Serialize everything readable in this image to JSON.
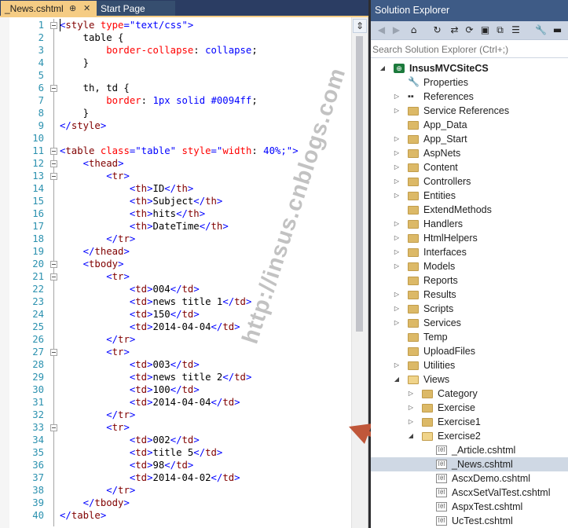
{
  "editor": {
    "tabs": [
      {
        "label": "_News.cshtml",
        "pin": "⊕",
        "close": "✕"
      },
      {
        "label": "Start Page"
      }
    ],
    "split_glyph": "⇕",
    "lines": [
      {
        "n": "1",
        "fold": true,
        "t": [
          [
            "b",
            "<"
          ],
          [
            "m",
            "style"
          ],
          [
            "r",
            " type"
          ],
          [
            "b",
            "=\""
          ],
          [
            "b",
            "text/css"
          ],
          [
            "b",
            "\">"
          ]
        ]
      },
      {
        "n": "2",
        "t": [
          [
            "k",
            "    table "
          ],
          [
            "k",
            "{"
          ]
        ]
      },
      {
        "n": "3",
        "t": [
          [
            "r",
            "        border-collapse"
          ],
          [
            "k",
            ": "
          ],
          [
            "b",
            "collapse"
          ],
          [
            "k",
            ";"
          ]
        ]
      },
      {
        "n": "4",
        "t": [
          [
            "k",
            "    }"
          ]
        ]
      },
      {
        "n": "5",
        "t": []
      },
      {
        "n": "6",
        "fold": true,
        "t": [
          [
            "k",
            "    th, td {"
          ]
        ]
      },
      {
        "n": "7",
        "t": [
          [
            "r",
            "        border"
          ],
          [
            "k",
            ": "
          ],
          [
            "b",
            "1px solid #0094ff"
          ],
          [
            "k",
            ";"
          ]
        ]
      },
      {
        "n": "8",
        "t": [
          [
            "k",
            "    }"
          ]
        ]
      },
      {
        "n": "9",
        "t": [
          [
            "b",
            "</"
          ],
          [
            "m",
            "style"
          ],
          [
            "b",
            ">"
          ]
        ]
      },
      {
        "n": "10",
        "t": []
      },
      {
        "n": "11",
        "fold": true,
        "t": [
          [
            "b",
            "<"
          ],
          [
            "m",
            "table"
          ],
          [
            "r",
            " class"
          ],
          [
            "b",
            "=\"table\""
          ],
          [
            "r",
            " style"
          ],
          [
            "b",
            "=\""
          ],
          [
            "r",
            "width"
          ],
          [
            "k",
            ": "
          ],
          [
            "b",
            "40%;"
          ],
          [
            "b",
            "\">"
          ]
        ]
      },
      {
        "n": "12",
        "fold": true,
        "t": [
          [
            "b",
            "    <"
          ],
          [
            "m",
            "thead"
          ],
          [
            "b",
            ">"
          ]
        ]
      },
      {
        "n": "13",
        "fold": true,
        "t": [
          [
            "b",
            "        <"
          ],
          [
            "m",
            "tr"
          ],
          [
            "b",
            ">"
          ]
        ]
      },
      {
        "n": "14",
        "t": [
          [
            "b",
            "            <"
          ],
          [
            "m",
            "th"
          ],
          [
            "b",
            ">"
          ],
          [
            "k",
            "ID"
          ],
          [
            "b",
            "</"
          ],
          [
            "m",
            "th"
          ],
          [
            "b",
            ">"
          ]
        ]
      },
      {
        "n": "15",
        "t": [
          [
            "b",
            "            <"
          ],
          [
            "m",
            "th"
          ],
          [
            "b",
            ">"
          ],
          [
            "k",
            "Subject"
          ],
          [
            "b",
            "</"
          ],
          [
            "m",
            "th"
          ],
          [
            "b",
            ">"
          ]
        ]
      },
      {
        "n": "16",
        "t": [
          [
            "b",
            "            <"
          ],
          [
            "m",
            "th"
          ],
          [
            "b",
            ">"
          ],
          [
            "k",
            "hits"
          ],
          [
            "b",
            "</"
          ],
          [
            "m",
            "th"
          ],
          [
            "b",
            ">"
          ]
        ]
      },
      {
        "n": "17",
        "t": [
          [
            "b",
            "            <"
          ],
          [
            "m",
            "th"
          ],
          [
            "b",
            ">"
          ],
          [
            "k",
            "DateTime"
          ],
          [
            "b",
            "</"
          ],
          [
            "m",
            "th"
          ],
          [
            "b",
            ">"
          ]
        ]
      },
      {
        "n": "18",
        "t": [
          [
            "b",
            "        </"
          ],
          [
            "m",
            "tr"
          ],
          [
            "b",
            ">"
          ]
        ]
      },
      {
        "n": "19",
        "t": [
          [
            "b",
            "    </"
          ],
          [
            "m",
            "thead"
          ],
          [
            "b",
            ">"
          ]
        ]
      },
      {
        "n": "20",
        "fold": true,
        "t": [
          [
            "b",
            "    <"
          ],
          [
            "m",
            "tbody"
          ],
          [
            "b",
            ">"
          ]
        ]
      },
      {
        "n": "21",
        "fold": true,
        "t": [
          [
            "b",
            "        <"
          ],
          [
            "m",
            "tr"
          ],
          [
            "b",
            ">"
          ]
        ]
      },
      {
        "n": "22",
        "t": [
          [
            "b",
            "            <"
          ],
          [
            "m",
            "td"
          ],
          [
            "b",
            ">"
          ],
          [
            "k",
            "004"
          ],
          [
            "b",
            "</"
          ],
          [
            "m",
            "td"
          ],
          [
            "b",
            ">"
          ]
        ]
      },
      {
        "n": "23",
        "t": [
          [
            "b",
            "            <"
          ],
          [
            "m",
            "td"
          ],
          [
            "b",
            ">"
          ],
          [
            "k",
            "news title 1"
          ],
          [
            "b",
            "</"
          ],
          [
            "m",
            "td"
          ],
          [
            "b",
            ">"
          ]
        ]
      },
      {
        "n": "24",
        "t": [
          [
            "b",
            "            <"
          ],
          [
            "m",
            "td"
          ],
          [
            "b",
            ">"
          ],
          [
            "k",
            "150"
          ],
          [
            "b",
            "</"
          ],
          [
            "m",
            "td"
          ],
          [
            "b",
            ">"
          ]
        ]
      },
      {
        "n": "25",
        "t": [
          [
            "b",
            "            <"
          ],
          [
            "m",
            "td"
          ],
          [
            "b",
            ">"
          ],
          [
            "k",
            "2014-04-04"
          ],
          [
            "b",
            "</"
          ],
          [
            "m",
            "td"
          ],
          [
            "b",
            ">"
          ]
        ]
      },
      {
        "n": "26",
        "t": [
          [
            "b",
            "        </"
          ],
          [
            "m",
            "tr"
          ],
          [
            "b",
            ">"
          ]
        ]
      },
      {
        "n": "27",
        "fold": true,
        "t": [
          [
            "b",
            "        <"
          ],
          [
            "m",
            "tr"
          ],
          [
            "b",
            ">"
          ]
        ]
      },
      {
        "n": "28",
        "t": [
          [
            "b",
            "            <"
          ],
          [
            "m",
            "td"
          ],
          [
            "b",
            ">"
          ],
          [
            "k",
            "003"
          ],
          [
            "b",
            "</"
          ],
          [
            "m",
            "td"
          ],
          [
            "b",
            ">"
          ]
        ]
      },
      {
        "n": "29",
        "t": [
          [
            "b",
            "            <"
          ],
          [
            "m",
            "td"
          ],
          [
            "b",
            ">"
          ],
          [
            "k",
            "news title 2"
          ],
          [
            "b",
            "</"
          ],
          [
            "m",
            "td"
          ],
          [
            "b",
            ">"
          ]
        ]
      },
      {
        "n": "30",
        "t": [
          [
            "b",
            "            <"
          ],
          [
            "m",
            "td"
          ],
          [
            "b",
            ">"
          ],
          [
            "k",
            "100"
          ],
          [
            "b",
            "</"
          ],
          [
            "m",
            "td"
          ],
          [
            "b",
            ">"
          ]
        ]
      },
      {
        "n": "31",
        "t": [
          [
            "b",
            "            <"
          ],
          [
            "m",
            "td"
          ],
          [
            "b",
            ">"
          ],
          [
            "k",
            "2014-04-04"
          ],
          [
            "b",
            "</"
          ],
          [
            "m",
            "td"
          ],
          [
            "b",
            ">"
          ]
        ]
      },
      {
        "n": "32",
        "t": [
          [
            "b",
            "        </"
          ],
          [
            "m",
            "tr"
          ],
          [
            "b",
            ">"
          ]
        ]
      },
      {
        "n": "33",
        "fold": true,
        "t": [
          [
            "b",
            "        <"
          ],
          [
            "m",
            "tr"
          ],
          [
            "b",
            ">"
          ]
        ]
      },
      {
        "n": "34",
        "t": [
          [
            "b",
            "            <"
          ],
          [
            "m",
            "td"
          ],
          [
            "b",
            ">"
          ],
          [
            "k",
            "002"
          ],
          [
            "b",
            "</"
          ],
          [
            "m",
            "td"
          ],
          [
            "b",
            ">"
          ]
        ]
      },
      {
        "n": "35",
        "t": [
          [
            "b",
            "            <"
          ],
          [
            "m",
            "td"
          ],
          [
            "b",
            ">"
          ],
          [
            "k",
            "title 5"
          ],
          [
            "b",
            "</"
          ],
          [
            "m",
            "td"
          ],
          [
            "b",
            ">"
          ]
        ]
      },
      {
        "n": "36",
        "t": [
          [
            "b",
            "            <"
          ],
          [
            "m",
            "td"
          ],
          [
            "b",
            ">"
          ],
          [
            "k",
            "98"
          ],
          [
            "b",
            "</"
          ],
          [
            "m",
            "td"
          ],
          [
            "b",
            ">"
          ]
        ]
      },
      {
        "n": "37",
        "t": [
          [
            "b",
            "            <"
          ],
          [
            "m",
            "td"
          ],
          [
            "b",
            ">"
          ],
          [
            "k",
            "2014-04-02"
          ],
          [
            "b",
            "</"
          ],
          [
            "m",
            "td"
          ],
          [
            "b",
            ">"
          ]
        ]
      },
      {
        "n": "38",
        "t": [
          [
            "b",
            "        </"
          ],
          [
            "m",
            "tr"
          ],
          [
            "b",
            ">"
          ]
        ]
      },
      {
        "n": "39",
        "t": [
          [
            "b",
            "    </"
          ],
          [
            "m",
            "tbody"
          ],
          [
            "b",
            ">"
          ]
        ]
      },
      {
        "n": "40",
        "t": [
          [
            "b",
            "</"
          ],
          [
            "m",
            "table"
          ],
          [
            "b",
            ">"
          ]
        ]
      }
    ]
  },
  "watermark": "http://insus.cnblogs.com",
  "colors": {
    "b": "#0000ff",
    "m": "#800000",
    "r": "#ff0000",
    "k": "#000000",
    "arrow": "#c0573a"
  },
  "solution_explorer": {
    "title": "Solution Explorer",
    "toolbar_icons": [
      "back-icon",
      "forward-icon",
      "home-icon",
      "history-icon",
      "sync-icon",
      "refresh-icon",
      "collapse-all-icon",
      "copy-icon",
      "show-all-icon",
      "properties-icon",
      "pin-icon"
    ],
    "toolbar_glyphs": [
      "◀",
      "▶",
      "⌂",
      "↻",
      "⇄",
      "⟳",
      "▣",
      "⧉",
      "☰",
      "🔧",
      "▬"
    ],
    "search_placeholder": "Search Solution Explorer (Ctrl+;)",
    "items": [
      {
        "label": "InsusMVCSiteCS",
        "icon": "proj",
        "level": 0,
        "exp": "◢",
        "bold": true
      },
      {
        "label": "Properties",
        "icon": "wrench",
        "level": 1
      },
      {
        "label": "References",
        "icon": "refs",
        "level": 1,
        "exp": "▷"
      },
      {
        "label": "Service References",
        "icon": "folder",
        "level": 1,
        "exp": "▷"
      },
      {
        "label": "App_Data",
        "icon": "folder",
        "level": 1
      },
      {
        "label": "App_Start",
        "icon": "folder",
        "level": 1,
        "exp": "▷"
      },
      {
        "label": "AspNets",
        "icon": "folder",
        "level": 1,
        "exp": "▷"
      },
      {
        "label": "Content",
        "icon": "folder",
        "level": 1,
        "exp": "▷"
      },
      {
        "label": "Controllers",
        "icon": "folder",
        "level": 1,
        "exp": "▷"
      },
      {
        "label": "Entities",
        "icon": "folder",
        "level": 1,
        "exp": "▷"
      },
      {
        "label": "ExtendMethods",
        "icon": "folder",
        "level": 1
      },
      {
        "label": "Handlers",
        "icon": "folder",
        "level": 1,
        "exp": "▷"
      },
      {
        "label": "HtmlHelpers",
        "icon": "folder",
        "level": 1,
        "exp": "▷"
      },
      {
        "label": "Interfaces",
        "icon": "folder",
        "level": 1,
        "exp": "▷"
      },
      {
        "label": "Models",
        "icon": "folder",
        "level": 1,
        "exp": "▷"
      },
      {
        "label": "Reports",
        "icon": "folder",
        "level": 1
      },
      {
        "label": "Results",
        "icon": "folder",
        "level": 1,
        "exp": "▷"
      },
      {
        "label": "Scripts",
        "icon": "folder",
        "level": 1,
        "exp": "▷"
      },
      {
        "label": "Services",
        "icon": "folder",
        "level": 1,
        "exp": "▷"
      },
      {
        "label": "Temp",
        "icon": "folder",
        "level": 1
      },
      {
        "label": "UploadFiles",
        "icon": "folder",
        "level": 1
      },
      {
        "label": "Utilities",
        "icon": "folder",
        "level": 1,
        "exp": "▷"
      },
      {
        "label": "Views",
        "icon": "folder-open",
        "level": 1,
        "exp": "◢"
      },
      {
        "label": "Category",
        "icon": "folder",
        "level": 2,
        "exp": "▷"
      },
      {
        "label": "Exercise",
        "icon": "folder",
        "level": 2,
        "exp": "▷"
      },
      {
        "label": "Exercise1",
        "icon": "folder",
        "level": 2,
        "exp": "▷"
      },
      {
        "label": "Exercise2",
        "icon": "folder-open",
        "level": 2,
        "exp": "◢"
      },
      {
        "label": "_Article.cshtml",
        "icon": "file",
        "level": 3
      },
      {
        "label": "_News.cshtml",
        "icon": "file",
        "level": 3,
        "selected": true
      },
      {
        "label": "AscxDemo.cshtml",
        "icon": "file",
        "level": 3
      },
      {
        "label": "AscxSetValTest.cshtml",
        "icon": "file",
        "level": 3
      },
      {
        "label": "AspxTest.cshtml",
        "icon": "file",
        "level": 3
      },
      {
        "label": "UcTest.cshtml",
        "icon": "file",
        "level": 3
      }
    ],
    "file_icon_text": "[@]"
  }
}
